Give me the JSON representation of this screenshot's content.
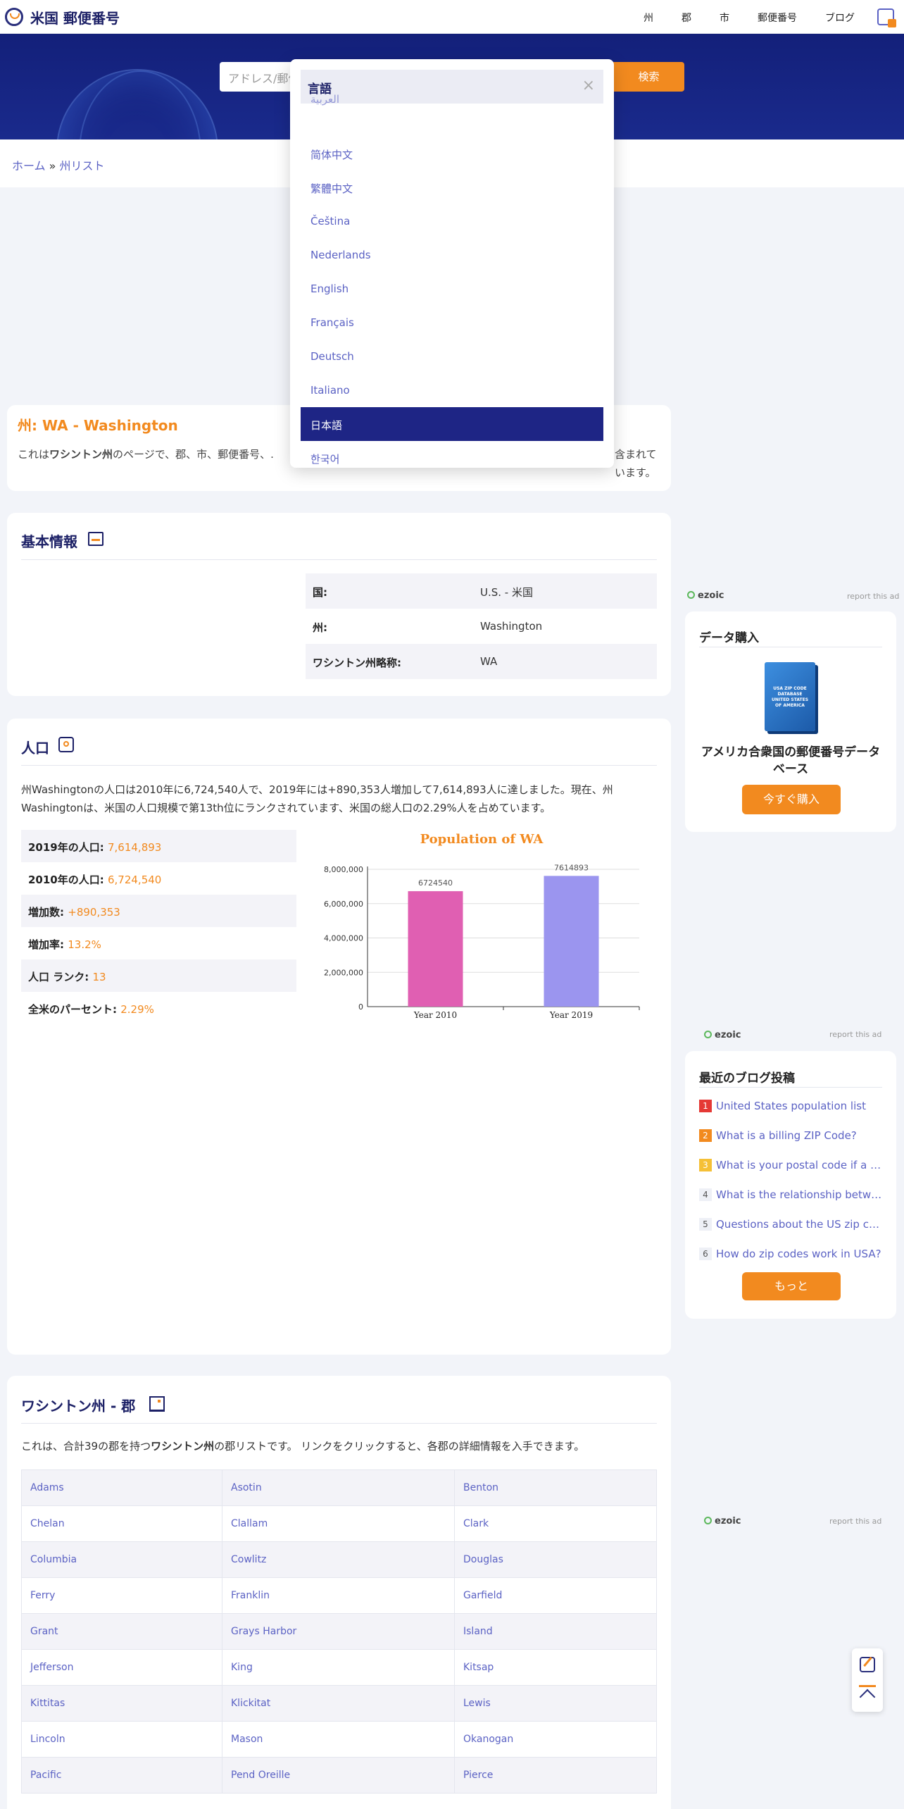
{
  "header": {
    "logo_text": "米国 郵便番号",
    "nav": [
      "州",
      "郡",
      "市",
      "郵便番号",
      "ブログ"
    ]
  },
  "search": {
    "placeholder": "アドレス/郵便",
    "button_label": "検索 "
  },
  "breadcrumb": {
    "home": "ホーム",
    "sep": " » ",
    "current": "州リスト"
  },
  "language_menu": {
    "title": "言語",
    "close": "×",
    "items": [
      "العربية",
      "简体中文",
      "繁體中文",
      "Čeština",
      "Nederlands",
      "English",
      "Français",
      "Deutsch",
      "Italiano",
      "日本語",
      "한국어"
    ],
    "active": "日本語"
  },
  "state": {
    "title": "州: WA - Washington",
    "desc_prefix": "これは",
    "desc_bold": "ワシントン州",
    "desc_middle": "のページで、郡、市、郵便番号、.",
    "desc_end": "含まれています。"
  },
  "basic_info": {
    "title": "基本情報",
    "rows": [
      {
        "k": "国:",
        "v": "U.S. - 米国"
      },
      {
        "k": "州:",
        "v": "Washington"
      },
      {
        "k": "ワシントン州略称:",
        "v": "WA"
      }
    ]
  },
  "population": {
    "title": "人口",
    "description": "州Washingtonの人口は2010年に6,724,540人で、2019年には+890,353人増加して7,614,893人に達しました。現在、州Washingtonは、米国の人口規模で第13th位にランクされています、米国の総人口の2.29%人を占めています。",
    "stats": [
      {
        "k": "2019年の人口",
        "v": "7,614,893"
      },
      {
        "k": "2010年の人口",
        "v": "6,724,540"
      },
      {
        "k": "増加数",
        "v": "+890,353"
      },
      {
        "k": "増加率",
        "v": "13.2%"
      },
      {
        "k": "人口 ランク",
        "v": "13"
      },
      {
        "k": "全米のパーセント",
        "v": "2.29%"
      }
    ]
  },
  "chart_data": {
    "type": "bar",
    "title": "Population of WA",
    "categories": [
      "Year 2010",
      "Year 2019"
    ],
    "values": [
      6724540,
      7614893
    ],
    "value_labels": [
      "6724540",
      "7614893"
    ],
    "colors": [
      "#e05fb2",
      "#9b95ef"
    ],
    "ylim": [
      0,
      8000000
    ],
    "yticks": [
      "0",
      "2,000,000",
      "4,000,000",
      "6,000,000",
      "8,000,000"
    ],
    "ytick_values": [
      0,
      2000000,
      4000000,
      6000000,
      8000000
    ],
    "grid": true
  },
  "counties": {
    "title": "ワシントン州 - 郡",
    "desc_prefix": "これは、合計39の郡を持つ",
    "desc_bold": "ワシントン州",
    "desc_suffix": "の郡リストです。 リンクをクリックすると、各郡の詳細情報を入手できます。",
    "rows": [
      [
        "Adams",
        "Asotin",
        "Benton"
      ],
      [
        "Chelan",
        "Clallam",
        "Clark"
      ],
      [
        "Columbia",
        "Cowlitz",
        "Douglas"
      ],
      [
        "Ferry",
        "Franklin",
        "Garfield"
      ],
      [
        "Grant",
        "Grays Harbor",
        "Island"
      ],
      [
        "Jefferson",
        "King",
        "Kitsap"
      ],
      [
        "Kittitas",
        "Klickitat",
        "Lewis"
      ],
      [
        "Lincoln",
        "Mason",
        "Okanogan"
      ],
      [
        "Pacific",
        "Pend Oreille",
        "Pierce"
      ]
    ]
  },
  "sidebar": {
    "ezoic": "ezoic",
    "report": "report this ad",
    "data_title": "データ購入 ",
    "product_label": "USA ZIP CODE DATABASE UNITED STATES OF AMERICA",
    "product_name": "アメリカ合衆国の郵便番号データベース",
    "buy_label": "今すぐ購入",
    "blog_title": "最近のブログ投稿",
    "blog_items": [
      "United States population list",
      "What is a billing ZIP Code?",
      "What is your postal code if a p…",
      "What is the relationship betwe…",
      "Questions about the US zip code",
      "How do zip codes work in USA?"
    ],
    "blog_colors": [
      "#e53935",
      "#f28a1f",
      "#f5c037",
      "#eef0f6",
      "#eef0f6",
      "#eef0f6"
    ],
    "more_label": "もっと"
  }
}
